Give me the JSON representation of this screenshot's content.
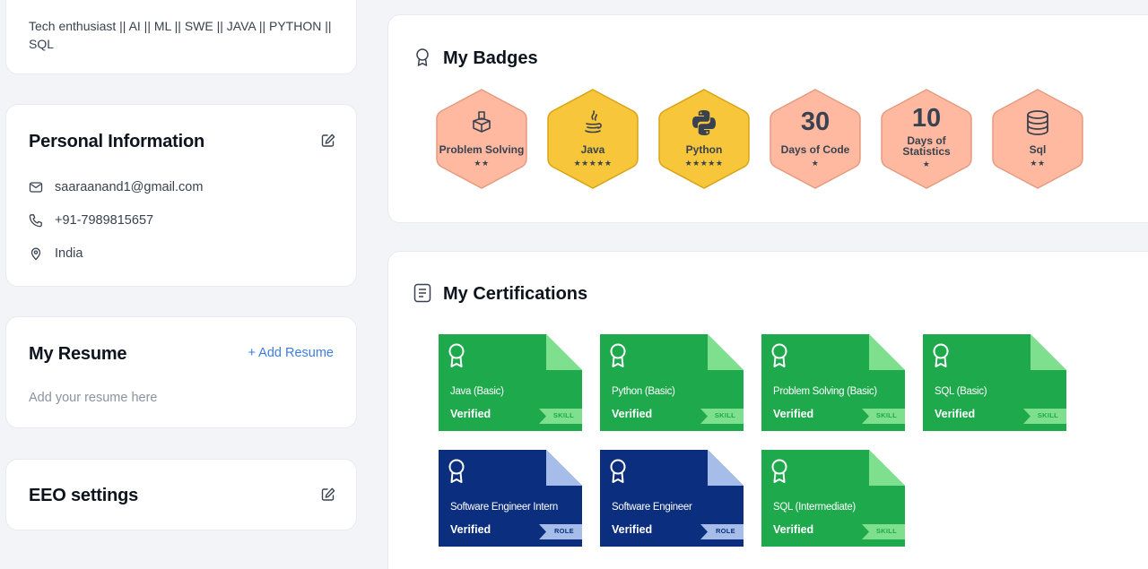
{
  "profile": {
    "bio": "Tech enthusiast || AI || ML || SWE || JAVA || PYTHON || SQL"
  },
  "personal_info": {
    "title": "Personal Information",
    "email": "saaraanand1@gmail.com",
    "phone": "+91-7989815657",
    "location": "India"
  },
  "resume": {
    "title": "My Resume",
    "add_label": "+ Add Resume",
    "hint": "Add your resume here"
  },
  "eeo": {
    "title": "EEO settings"
  },
  "badges": {
    "title": "My Badges",
    "items": [
      {
        "label": "Problem Solving",
        "stars": "★★",
        "icon": "problem-solving-icon",
        "color": "orange"
      },
      {
        "label": "Java",
        "stars": "★★★★★",
        "icon": "java-icon",
        "color": "gold"
      },
      {
        "label": "Python",
        "stars": "★★★★★",
        "icon": "python-icon",
        "color": "gold"
      },
      {
        "number": "30",
        "label": "Days of Code",
        "stars": "★",
        "color": "orange"
      },
      {
        "number": "10",
        "label_line1": "Days of",
        "label_line2": "Statistics",
        "stars": "★",
        "color": "orange"
      },
      {
        "label": "Sql",
        "stars": "★★",
        "icon": "database-icon",
        "color": "orange"
      }
    ]
  },
  "certifications": {
    "title": "My Certifications",
    "verified_label": "Verified",
    "items": [
      {
        "name": "Java (Basic)",
        "tag": "SKILL",
        "kind": "skill"
      },
      {
        "name": "Python (Basic)",
        "tag": "SKILL",
        "kind": "skill"
      },
      {
        "name": "Problem Solving (Basic)",
        "tag": "SKILL",
        "kind": "skill"
      },
      {
        "name": "SQL (Basic)",
        "tag": "SKILL",
        "kind": "skill"
      },
      {
        "name": "Software Engineer Intern",
        "tag": "ROLE",
        "kind": "role"
      },
      {
        "name": "Software Engineer",
        "tag": "ROLE",
        "kind": "role"
      },
      {
        "name": "SQL (Intermediate)",
        "tag": "SKILL",
        "kind": "skill"
      }
    ]
  },
  "colors": {
    "skill_green": "#1ea94c",
    "skill_fold": "#7ee08e",
    "role_blue": "#0b2f7e",
    "role_fold": "#a5bde8",
    "badge_orange": "#ffb9a1",
    "badge_gold": "#f7c63a",
    "link_blue": "#3c7ee0"
  }
}
